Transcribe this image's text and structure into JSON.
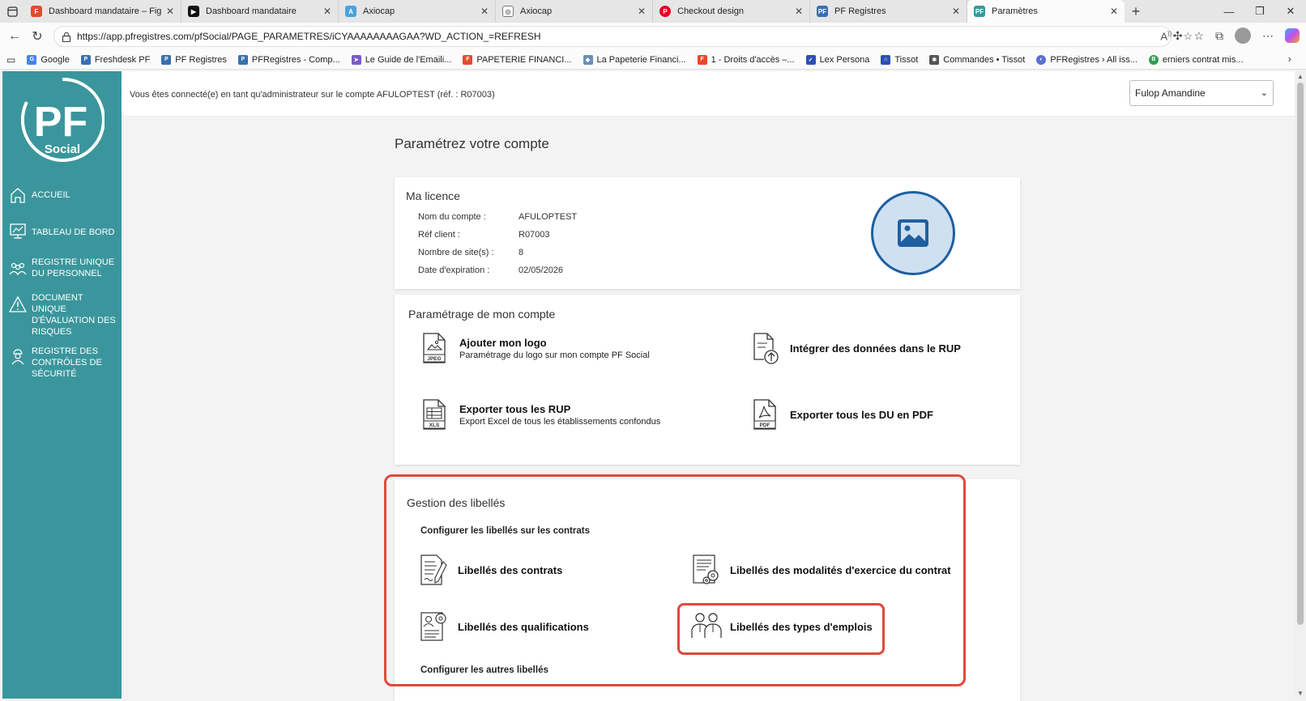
{
  "browser": {
    "tabs": [
      {
        "title": "Dashboard mandataire – Figma",
        "icon": "figma-icon",
        "color": "#e24c2c"
      },
      {
        "title": "Dashboard mandataire",
        "icon": "play-icon",
        "color": "#111111"
      },
      {
        "title": "Axiocap",
        "icon": "axiocap-icon",
        "color": "#4aa3df"
      },
      {
        "title": "Axiocap",
        "icon": "globe-icon",
        "color": "#777777"
      },
      {
        "title": "Checkout design",
        "icon": "pinterest-icon",
        "color": "#e60023"
      },
      {
        "title": "PF Registres",
        "icon": "pf-icon",
        "color": "#3a6fb0"
      },
      {
        "title": "Paramètres",
        "icon": "pf-icon",
        "color": "#3a969c"
      }
    ],
    "url": "https://app.pfregistres.com/pfSocial/PAGE_PARAMETRES/iCYAAAAAAAAGAA?WD_ACTION_=REFRESH",
    "bookmarks": [
      {
        "label": "Google",
        "color": "#4285f4"
      },
      {
        "label": "Freshdesk PF",
        "color": "#3a6fb0"
      },
      {
        "label": "PF Registres",
        "color": "#3a6fb0"
      },
      {
        "label": "PFRegistres - Comp...",
        "color": "#3a6fb0"
      },
      {
        "label": "Le Guide de l'Emaili...",
        "color": "#7b5cc7"
      },
      {
        "label": "PAPETERIE FINANCI...",
        "color": "#e24c2c"
      },
      {
        "label": "La Papeterie Financi...",
        "color": "#6a8fb8"
      },
      {
        "label": "1 - Droits d'accès –...",
        "color": "#e24c2c"
      },
      {
        "label": "Lex Persona",
        "color": "#2d4fb3"
      },
      {
        "label": "Tissot",
        "color": "#2d4fb3"
      },
      {
        "label": "Commandes • Tissot",
        "color": "#555555"
      },
      {
        "label": "PFRegistres › All iss...",
        "color": "#5b6ed6"
      },
      {
        "label": "erniers contrat mis...",
        "color": "#2e9e4f"
      }
    ]
  },
  "sidebar": {
    "logo_text": "PF",
    "logo_sub": "Social",
    "items": [
      {
        "label": "ACCUEIL",
        "icon": "home-icon"
      },
      {
        "label": "TABLEAU DE BORD",
        "icon": "dashboard-icon"
      },
      {
        "label": "REGISTRE UNIQUE DU PERSONNEL",
        "icon": "people-icon"
      },
      {
        "label": "DOCUMENT UNIQUE D'ÉVALUATION DES RISQUES",
        "icon": "warning-icon"
      },
      {
        "label": "REGISTRE DES CONTRÔLES DE SÉCURITÉ",
        "icon": "worker-icon"
      }
    ],
    "bg_color": "#3a969c"
  },
  "header": {
    "connection_message": "Vous êtes connecté(e) en tant qu'administrateur sur le compte AFULOPTEST (réf. : R07003)",
    "user_select": "Fulop Amandine"
  },
  "page_title": "Paramétrez votre compte",
  "licence": {
    "title": "Ma licence",
    "rows": [
      {
        "label": "Nom du compte :",
        "value": "AFULOPTEST"
      },
      {
        "label": "Réf client :",
        "value": "R07003"
      },
      {
        "label": "Nombre de site(s) :",
        "value": "8"
      },
      {
        "label": "Date d'expiration :",
        "value": "02/05/2026"
      }
    ]
  },
  "account_settings": {
    "title": "Paramétrage de mon compte",
    "options": [
      {
        "title": "Ajouter mon logo",
        "subtitle": "Paramétrage du logo sur mon compte PF Social",
        "icon": "jpeg-file-icon"
      },
      {
        "title": "Intégrer des données dans le RUP",
        "subtitle": "",
        "icon": "upload-file-icon"
      },
      {
        "title": "Exporter tous les RUP",
        "subtitle": "Export Excel de tous les établissements confondus",
        "icon": "xls-file-icon"
      },
      {
        "title": "Exporter tous les DU en PDF",
        "subtitle": "",
        "icon": "pdf-file-icon"
      }
    ]
  },
  "labels": {
    "title": "Gestion des libellés",
    "contracts_subtitle": "Configurer les libellés sur les contrats",
    "options": [
      {
        "title": "Libellés des contrats",
        "icon": "contract-icon"
      },
      {
        "title": "Libellés des modalités d'exercice du contrat",
        "icon": "contract-settings-icon"
      },
      {
        "title": "Libellés des qualifications",
        "icon": "qualification-icon"
      },
      {
        "title": "Libellés des types d'emplois",
        "icon": "employees-icon"
      }
    ],
    "other_subtitle": "Configurer les autres libellés"
  },
  "colors": {
    "teal": "#3a969c",
    "highlight": "#e0493c",
    "photo_circle": "#1f5fa0"
  }
}
